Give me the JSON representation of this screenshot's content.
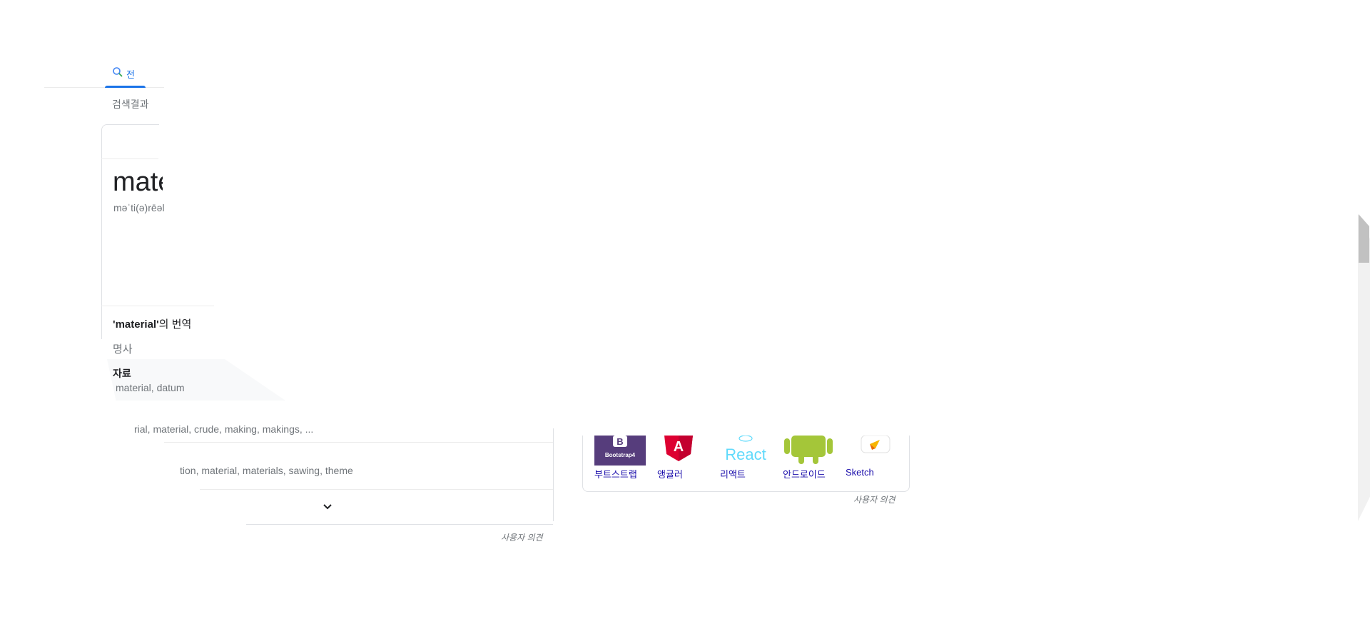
{
  "search_tab": {
    "label": "전",
    "icon": "search-icon"
  },
  "result_stats": "검색결과",
  "dictionary": {
    "word": "material",
    "phonetic": "məˈti(ə)rēəl"
  },
  "translations": {
    "heading_word": "'material'",
    "heading_suffix": "의 번역",
    "part_of_speech": "명사",
    "rows": [
      {
        "word": "자료",
        "synonyms": "material, datum"
      },
      {
        "word": "",
        "synonyms": "rial, material, crude, making, makings, ..."
      },
      {
        "word": "",
        "synonyms": "tion, material, materials, sawing, theme"
      }
    ],
    "expand_icon": "chevron-down-icon",
    "feedback": "사용자 의견"
  },
  "related": {
    "items": [
      {
        "label": "부트스트랩",
        "icon": "bootstrap-logo",
        "badge": "Bootstrap4"
      },
      {
        "label": "앵귤러",
        "icon": "angular-logo",
        "badge": "A"
      },
      {
        "label": "리액트",
        "icon": "react-logo",
        "badge": "React"
      },
      {
        "label": "안드로이드",
        "icon": "android-logo"
      },
      {
        "label": "Sketch",
        "icon": "sketch-logo"
      }
    ],
    "feedback": "사용자 의견"
  },
  "colors": {
    "accent": "#1a73e8",
    "link": "#1a0dab",
    "muted": "#70757a",
    "bootstrap": "#563d7c",
    "angular": "#dd0031",
    "react": "#61dafb",
    "android": "#a4c639",
    "sketch": "#f7b500"
  }
}
